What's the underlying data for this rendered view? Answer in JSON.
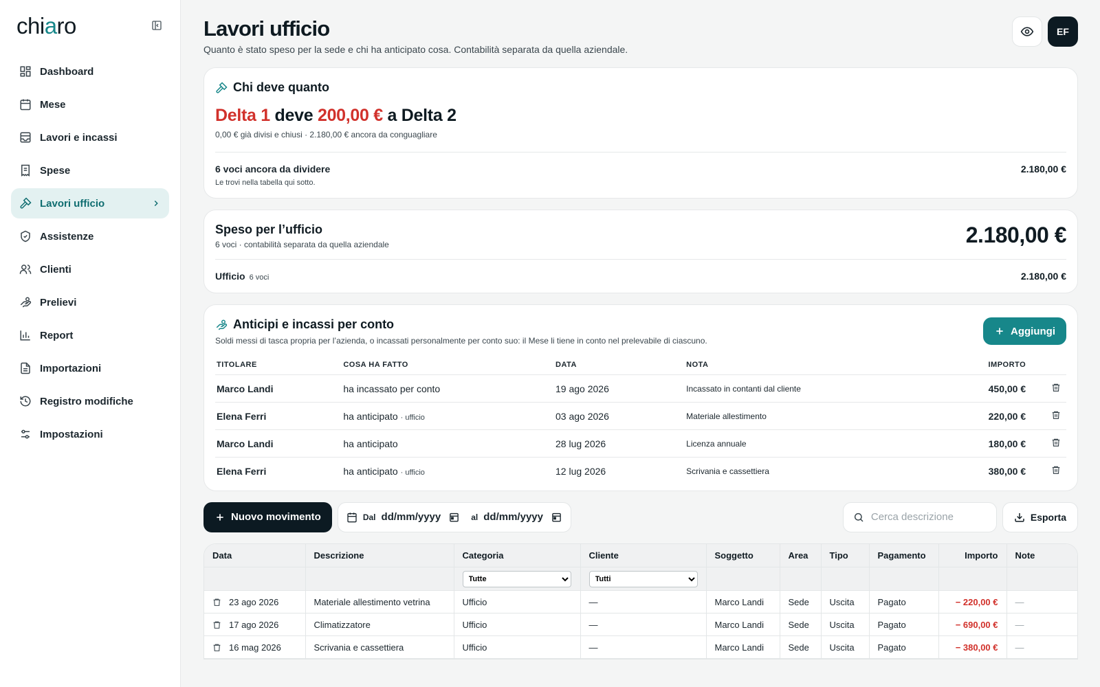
{
  "sidebar": {
    "logo_pre": "chi",
    "logo_accent": "a",
    "logo_post": "ro",
    "items": [
      {
        "label": "Dashboard",
        "icon": "grid-icon"
      },
      {
        "label": "Mese",
        "icon": "calendar-icon"
      },
      {
        "label": "Lavori e incassi",
        "icon": "inbox-icon"
      },
      {
        "label": "Spese",
        "icon": "receipt-icon"
      },
      {
        "label": "Lavori ufficio",
        "icon": "hammer-icon",
        "active": true
      },
      {
        "label": "Assistenze",
        "icon": "shield-icon"
      },
      {
        "label": "Clienti",
        "icon": "users-icon"
      },
      {
        "label": "Prelievi",
        "icon": "hand-coins-icon"
      },
      {
        "label": "Report",
        "icon": "bar-chart-icon"
      },
      {
        "label": "Importazioni",
        "icon": "file-icon"
      },
      {
        "label": "Registro modifiche",
        "icon": "history-icon"
      },
      {
        "label": "Impostazioni",
        "icon": "sliders-icon"
      }
    ]
  },
  "header": {
    "title": "Lavori ufficio",
    "subtitle": "Quanto è stato speso per la sede e chi ha anticipato cosa. Contabilità separata da quella aziendale.",
    "avatar": "EF"
  },
  "debt": {
    "title": "Chi deve quanto",
    "debtor": "Delta 1",
    "verb": " deve ",
    "amount": "200,00 €",
    "to": " a Delta 2",
    "meta": "0,00 € già divisi e chiusi · 2.180,00 € ancora da conguagliare",
    "pending_title": "6 voci ancora da dividere",
    "pending_hint": "Le trovi nella tabella qui sotto.",
    "pending_amount": "2.180,00 €"
  },
  "spent": {
    "title": "Speso per l’ufficio",
    "sub": "6 voci · contabilità separata da quella aziendale",
    "total": "2.180,00 €",
    "office_label": "Ufficio",
    "office_count": "6 voci",
    "office_amount": "2.180,00 €"
  },
  "advances": {
    "title": "Anticipi e incassi per conto",
    "sub": "Soldi messi di tasca propria per l’azienda, o incassati personalmente per conto suo: il Mese li tiene in conto nel prelevabile di ciascuno.",
    "add_label": "Aggiungi",
    "columns": [
      "TITOLARE",
      "COSA HA FATTO",
      "DATA",
      "NOTA",
      "IMPORTO"
    ],
    "rows": [
      {
        "owner": "Marco Landi",
        "action": "ha incassato per conto",
        "tag": "",
        "date": "19 ago 2026",
        "note": "Incassato in contanti dal cliente",
        "amount": "450,00 €"
      },
      {
        "owner": "Elena Ferri",
        "action": "ha anticipato",
        "tag": "· ufficio",
        "date": "03 ago 2026",
        "note": "Materiale allestimento",
        "amount": "220,00 €"
      },
      {
        "owner": "Marco Landi",
        "action": "ha anticipato",
        "tag": "",
        "date": "28 lug 2026",
        "note": "Licenza annuale",
        "amount": "180,00 €"
      },
      {
        "owner": "Elena Ferri",
        "action": "ha anticipato",
        "tag": "· ufficio",
        "date": "12 lug 2026",
        "note": "Scrivania e cassettiera",
        "amount": "380,00 €"
      }
    ]
  },
  "toolbar": {
    "new_label": "Nuovo movimento",
    "from_label": "Dal",
    "to_label": "al",
    "date_placeholder": "dd/mm/yyyy",
    "search_placeholder": "Cerca descrizione",
    "export_label": "Esporta"
  },
  "movements": {
    "columns": [
      "Data",
      "Descrizione",
      "Categoria",
      "Cliente",
      "Soggetto",
      "Area",
      "Tipo",
      "Pagamento",
      "Importo",
      "Note"
    ],
    "filter_category": "Tutte",
    "filter_client": "Tutti",
    "rows": [
      {
        "date": "23 ago 2026",
        "desc": "Materiale allestimento vetrina",
        "cat": "Ufficio",
        "client": "—",
        "subject": "Marco Landi",
        "area": "Sede",
        "type": "Uscita",
        "payment": "Pagato",
        "amount": "− 220,00 €",
        "note": "—"
      },
      {
        "date": "17 ago 2026",
        "desc": "Climatizzatore",
        "cat": "Ufficio",
        "client": "—",
        "subject": "Marco Landi",
        "area": "Sede",
        "type": "Uscita",
        "payment": "Pagato",
        "amount": "− 690,00 €",
        "note": "—"
      },
      {
        "date": "16 mag 2026",
        "desc": "Scrivania e cassettiera",
        "cat": "Ufficio",
        "client": "—",
        "subject": "Marco Landi",
        "area": "Sede",
        "type": "Uscita",
        "payment": "Pagato",
        "amount": "− 380,00 €",
        "note": "—"
      }
    ]
  }
}
